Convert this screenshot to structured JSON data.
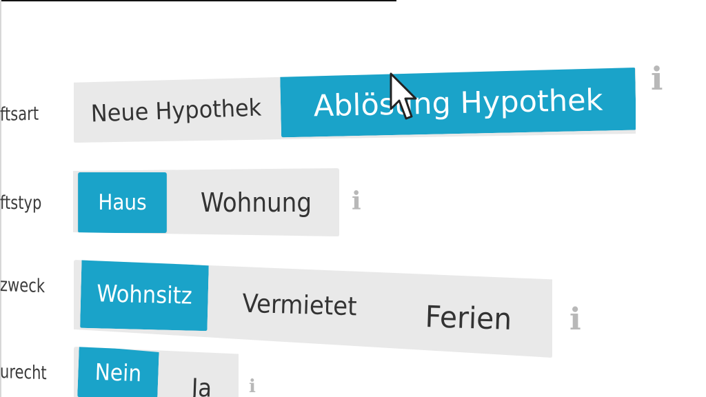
{
  "labels": {
    "row1": "ftsart",
    "row2": "ftstyp",
    "row3": "zweck",
    "row4": "urecht"
  },
  "rows": [
    {
      "options": [
        "Neue Hypothek",
        "Ablösung Hypothek"
      ],
      "selected": "Ablösung Hypothek"
    },
    {
      "options": [
        "Haus",
        "Wohnung"
      ],
      "selected": "Haus"
    },
    {
      "options": [
        "Wohnsitz",
        "Vermietet",
        "Ferien"
      ],
      "selected": "Wohnsitz"
    },
    {
      "options": [
        "Nein",
        "Ja"
      ],
      "selected": "Nein"
    }
  ],
  "icons": {
    "info": "i",
    "cursor": "mouse-pointer-icon"
  },
  "colors": {
    "accent": "#1aa3c9",
    "segment_bg": "#e9e9e9",
    "info_icon": "#b8b8b8",
    "text": "#333333"
  }
}
